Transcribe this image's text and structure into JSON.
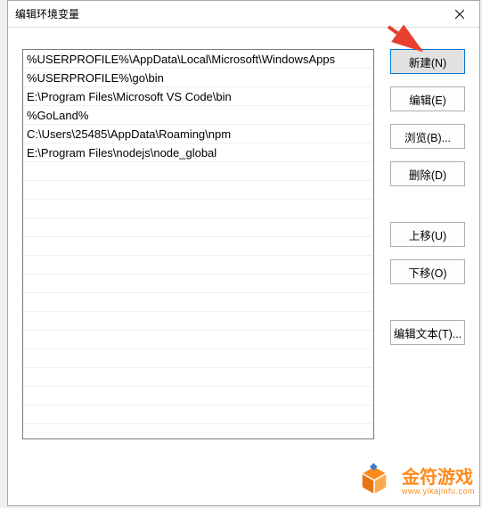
{
  "dialog": {
    "title": "编辑环境变量"
  },
  "paths": [
    "%USERPROFILE%\\AppData\\Local\\Microsoft\\WindowsApps",
    "%USERPROFILE%\\go\\bin",
    "E:\\Program Files\\Microsoft VS Code\\bin",
    "%GoLand%",
    "C:\\Users\\25485\\AppData\\Roaming\\npm",
    "E:\\Program Files\\nodejs\\node_global"
  ],
  "buttons": {
    "new": "新建(N)",
    "edit": "编辑(E)",
    "browse": "浏览(B)...",
    "delete": "删除(D)",
    "moveUp": "上移(U)",
    "moveDown": "下移(O)",
    "editText": "编辑文本(T)..."
  },
  "watermark": {
    "brand": "金符游戏",
    "url": "www.yikajinfu.com"
  },
  "colors": {
    "arrow": "#e8402f",
    "brand": "#fd8a1e"
  }
}
